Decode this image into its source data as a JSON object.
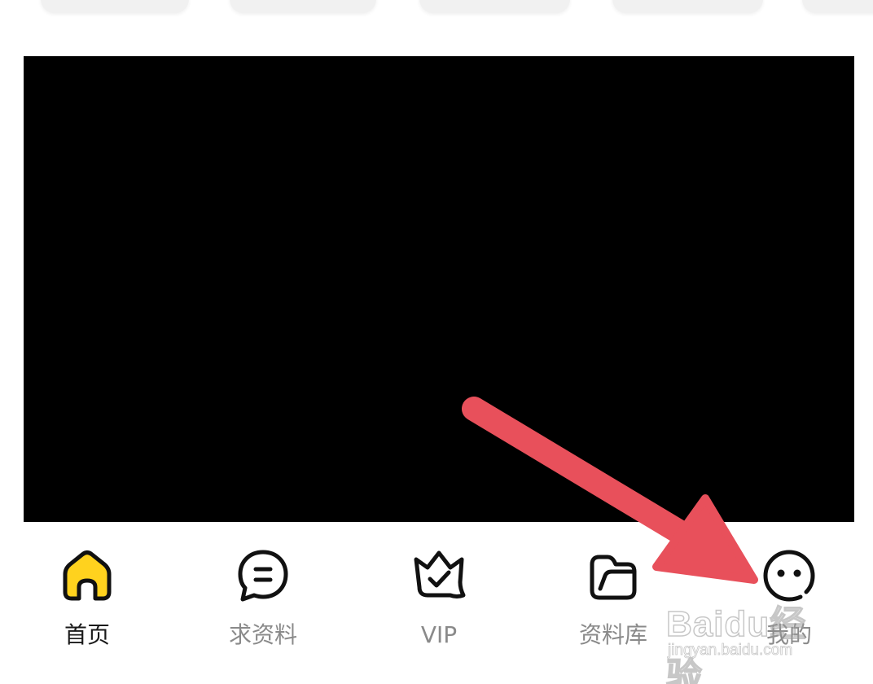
{
  "tabbar": {
    "items": [
      {
        "label": "首页",
        "icon": "home-icon",
        "active": true
      },
      {
        "label": "求资料",
        "icon": "chat-bubble-icon",
        "active": false
      },
      {
        "label": "VIP",
        "icon": "crown-icon",
        "active": false
      },
      {
        "label": "资料库",
        "icon": "folder-icon",
        "active": false
      },
      {
        "label": "我的",
        "icon": "smiley-face-icon",
        "active": false
      }
    ]
  },
  "watermark": {
    "main": "Baidu经验",
    "sub": "jingyan.baidu.com"
  },
  "colors": {
    "accent_yellow": "#FFD21E",
    "icon_stroke": "#111111",
    "label_inactive": "#8a8a8a",
    "label_active": "#1a1a1a",
    "annotation_arrow": "#E8505B",
    "video_background": "#000000"
  }
}
